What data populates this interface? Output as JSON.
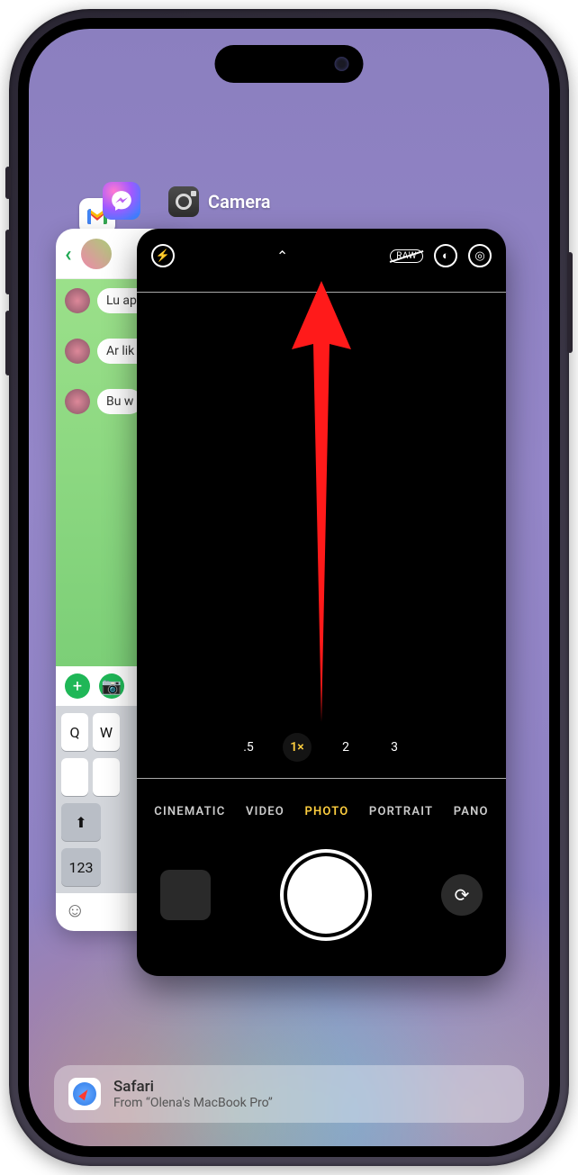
{
  "switcher": {
    "camera_label": "Camera",
    "back_stack_icons": {
      "gmail": "gmail-icon",
      "messenger": "messenger-icon"
    }
  },
  "messages_card": {
    "bubbles": [
      "Lu\nap\nth",
      "Ar\nlik\nis",
      "Bu\nw"
    ],
    "keys_row1": [
      "Q",
      "W"
    ],
    "num_key": "123"
  },
  "camera_card": {
    "top_icons": {
      "flash": "flash-icon",
      "chevron": "chevron-up-icon",
      "raw": "RAW",
      "live": "live-photo-icon",
      "filters": "filters-icon"
    },
    "zoom": {
      "options": [
        ".5",
        "1×",
        "2",
        "3"
      ],
      "active_index": 1
    },
    "modes": {
      "options": [
        "CINEMATIC",
        "VIDEO",
        "PHOTO",
        "PORTRAIT",
        "PANO"
      ],
      "active_index": 2
    }
  },
  "handoff": {
    "title": "Safari",
    "subtitle": "From “Olena's MacBook Pro”"
  },
  "annotation": {
    "arrow_color": "#ff1a1a"
  }
}
